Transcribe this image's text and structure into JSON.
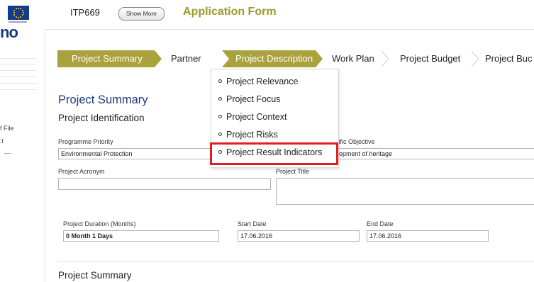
{
  "header": {
    "itp_code": "ITP669",
    "show_more_label": "Show More",
    "app_title": "Application Form"
  },
  "sidebar": {
    "logo_text": "no",
    "items": [
      "f File",
      ":t"
    ]
  },
  "tabs": [
    {
      "label": "Project Summary",
      "active": true
    },
    {
      "label": "Partner",
      "active": false
    },
    {
      "label": "Project Description",
      "active": true
    },
    {
      "label": "Work Plan",
      "active": false
    },
    {
      "label": "Project Budget",
      "active": false
    },
    {
      "label": "Project Buc",
      "active": false
    }
  ],
  "dropdown": {
    "items": [
      "Project Relevance",
      "Project Focus",
      "Project Context",
      "Project Risks",
      "Project Result Indicators"
    ],
    "highlighted_index": 4
  },
  "form": {
    "section_title": "Project Summary",
    "subsection_title": "Project Identification",
    "programme_priority_label": "Programme Priority",
    "programme_priority_value": "Environmental Protection",
    "specific_objective_label": "ecific Objective",
    "specific_objective_value": "relopment of heritage",
    "acronym_label": "Project Acronym",
    "acronym_value": "",
    "title_label": "Project Title",
    "title_value": "",
    "duration_label": "Project Duration (Months)",
    "duration_value": "0 Month 1 Days",
    "start_date_label": "Start Date",
    "start_date_value": "17.06.2016",
    "end_date_label": "End Date",
    "end_date_value": "17.06.2016",
    "summary_heading": "Project Summary"
  },
  "colors": {
    "tab_active": "#a9a23d",
    "title_olive": "#9a9a2e",
    "section_blue": "#1f3b7d",
    "highlight_red": "#e02020"
  }
}
